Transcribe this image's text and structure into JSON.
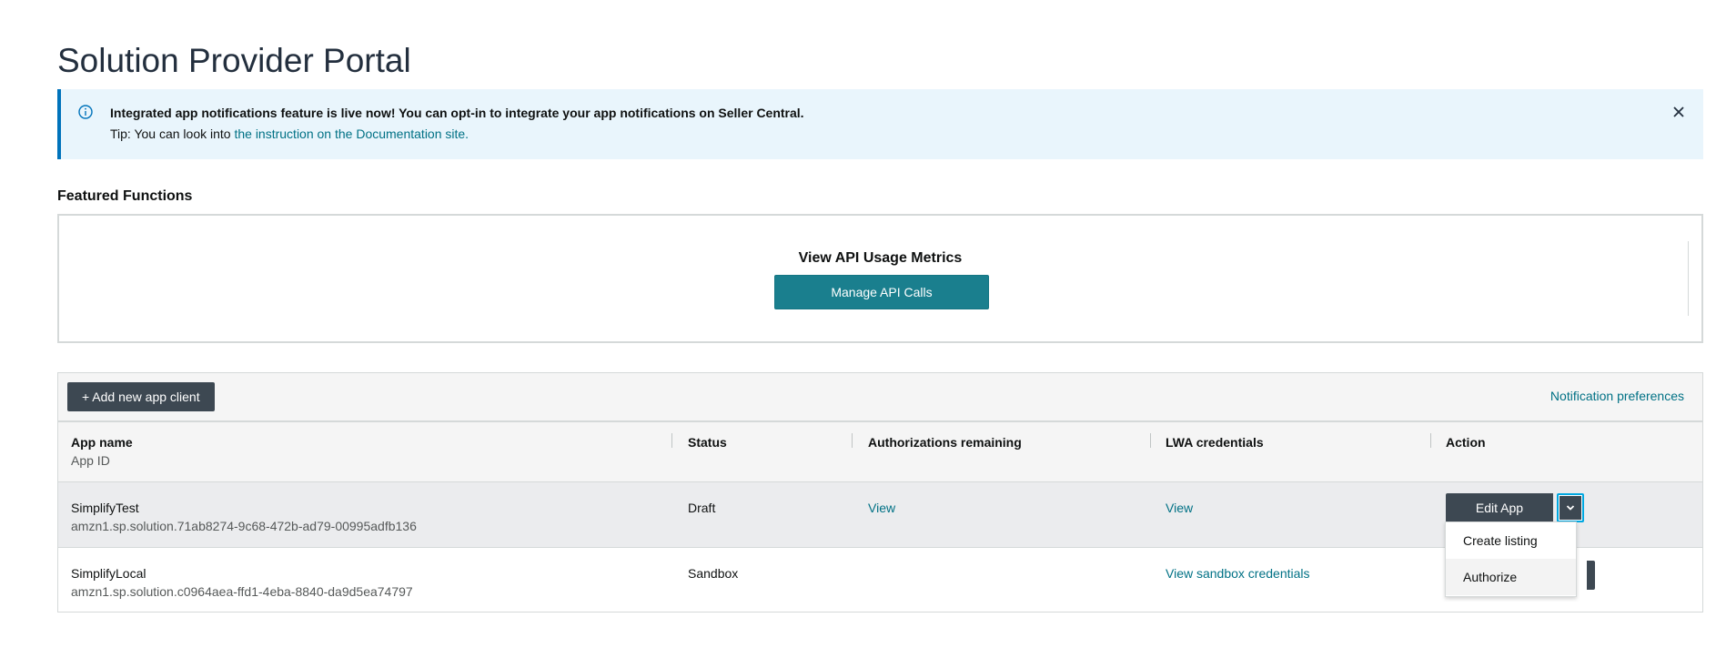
{
  "page": {
    "title": "Solution Provider Portal"
  },
  "alert": {
    "message": "Integrated app notifications feature is live now! You can opt-in to integrate your app notifications on Seller Central.",
    "tip_prefix": "Tip: You can look into ",
    "tip_link": "the instruction on the Documentation site."
  },
  "featured": {
    "heading": "Featured Functions",
    "card_title": "View API Usage Metrics",
    "button_label": "Manage API Calls"
  },
  "toolbar": {
    "add_label": "+ Add new app client",
    "notification_link": "Notification preferences"
  },
  "table": {
    "headers": {
      "app_name": "App name",
      "app_id": "App ID",
      "status": "Status",
      "authorizations": "Authorizations remaining",
      "lwa": "LWA credentials",
      "action": "Action"
    },
    "rows": [
      {
        "name": "SimplifyTest",
        "id": "amzn1.sp.solution.71ab8274-9c68-472b-ad79-00995adfb136",
        "status": "Draft",
        "authorizations": "View",
        "lwa": "View",
        "action": "Edit App"
      },
      {
        "name": "SimplifyLocal",
        "id": "amzn1.sp.solution.c0964aea-ffd1-4eba-8840-da9d5ea74797",
        "status": "Sandbox",
        "authorizations": "",
        "lwa": "View sandbox credentials"
      }
    ]
  },
  "dropdown": {
    "items": [
      "Create listing",
      "Authorize"
    ]
  },
  "colors": {
    "accent": "#007185",
    "primary_button": "#1a7f8e",
    "dark_button": "#3d4852",
    "alert_bg": "#e9f5fc",
    "alert_border": "#0073bb"
  },
  "icons": [
    "info-icon",
    "close-icon",
    "chevron-down-icon"
  ]
}
